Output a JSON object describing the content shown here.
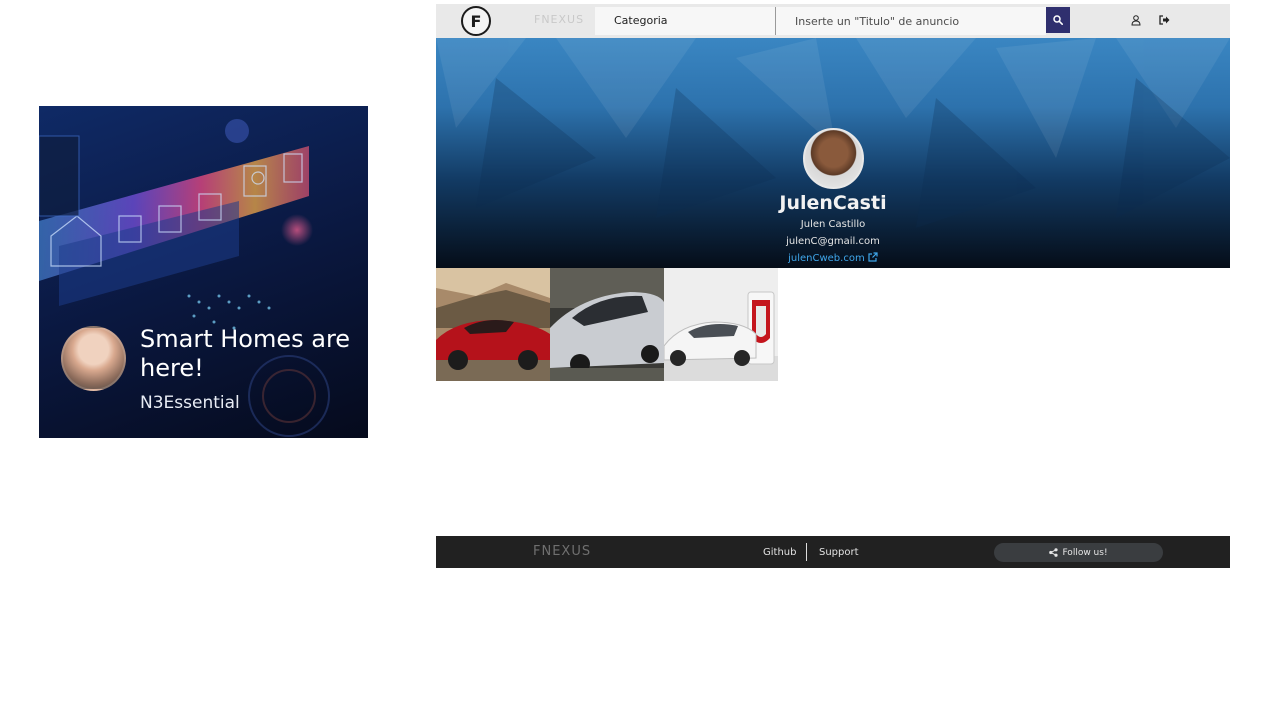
{
  "ad": {
    "title": "Smart Homes are here!",
    "brand": "N3Essential"
  },
  "header": {
    "logo_letter": "F",
    "brand": "FNEXUS",
    "category_label": "Categoria",
    "search_placeholder": "Inserte un \"Titulo\" de anuncio",
    "icons": [
      "search-icon",
      "user-icon",
      "logout-icon"
    ]
  },
  "profile": {
    "username": "JulenCasti",
    "full_name": "Julen Castillo",
    "email": "julenC@gmail.com",
    "website": "julenCweb.com"
  },
  "gallery": {
    "items": [
      {
        "alt": "red-car-photo",
        "color": "#b5121b"
      },
      {
        "alt": "silver-car-photo",
        "color": "#c9ccd1"
      },
      {
        "alt": "white-car-charging-photo",
        "color": "#f2f2f2"
      }
    ]
  },
  "footer": {
    "brand": "FNEXUS",
    "links": [
      "Github",
      "Support"
    ],
    "follow_label": "Follow us!"
  },
  "colors": {
    "search_button": "#2f2f6e",
    "footer": "#212121",
    "link": "#3fa6ea"
  }
}
